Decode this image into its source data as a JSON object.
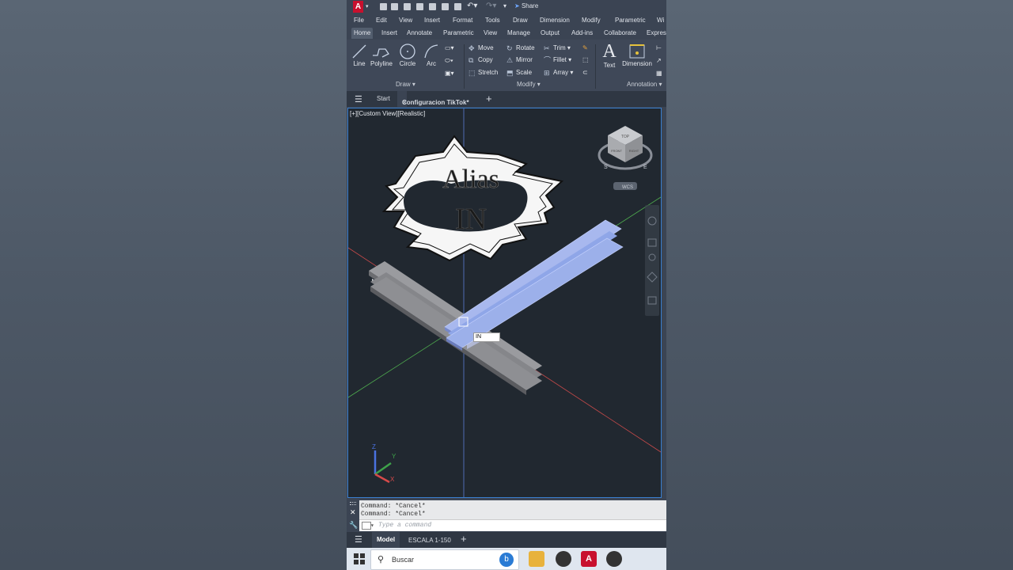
{
  "qat": {
    "share_label": "Share"
  },
  "menu": [
    "File",
    "Edit",
    "View",
    "Insert",
    "Format",
    "Tools",
    "Draw",
    "Dimension",
    "Modify",
    "Parametric",
    "Wi"
  ],
  "ribbon_tabs": [
    "Home",
    "Insert",
    "Annotate",
    "Parametric",
    "View",
    "Manage",
    "Output",
    "Add-ins",
    "Collaborate",
    "Express"
  ],
  "draw_tools": [
    "Line",
    "Polyline",
    "Circle",
    "Arc"
  ],
  "modify_tools": [
    "Move",
    "Rotate",
    "Trim",
    "Copy",
    "Mirror",
    "Fillet",
    "Stretch",
    "Scale",
    "Array"
  ],
  "annotation_tools": [
    "Text",
    "Dimension"
  ],
  "panels": {
    "draw": "Draw",
    "modify": "Modify",
    "annotation": "Annotation"
  },
  "doc_tabs": {
    "start": "Start",
    "current": "Configuracion TikTok*"
  },
  "viewport": {
    "label": "[+][Custom View][Realistic]",
    "wcs": "WCS",
    "input_value": "IN",
    "sticker_line1": "Alias",
    "sticker_line2": "IN",
    "cube_face": "FRONT",
    "cube_top": "TOP",
    "cube_right": "RIGHT"
  },
  "axes": {
    "z": "Z",
    "y": "Y",
    "x": "X"
  },
  "compass": {
    "s": "S",
    "e": "E"
  },
  "command": {
    "history": [
      "Command: *Cancel*",
      "Command: *Cancel*"
    ],
    "placeholder": "Type a command"
  },
  "layout_tabs": {
    "model": "Model",
    "layout1": "ESCALA 1-150"
  },
  "taskbar": {
    "search_label": "Buscar"
  },
  "colors": {
    "accent": "#3a7fd0",
    "brand": "#c8102e",
    "viewport_bg": "#212830",
    "beam_selected": "#8fa6e8",
    "beam": "#8e8f93"
  }
}
